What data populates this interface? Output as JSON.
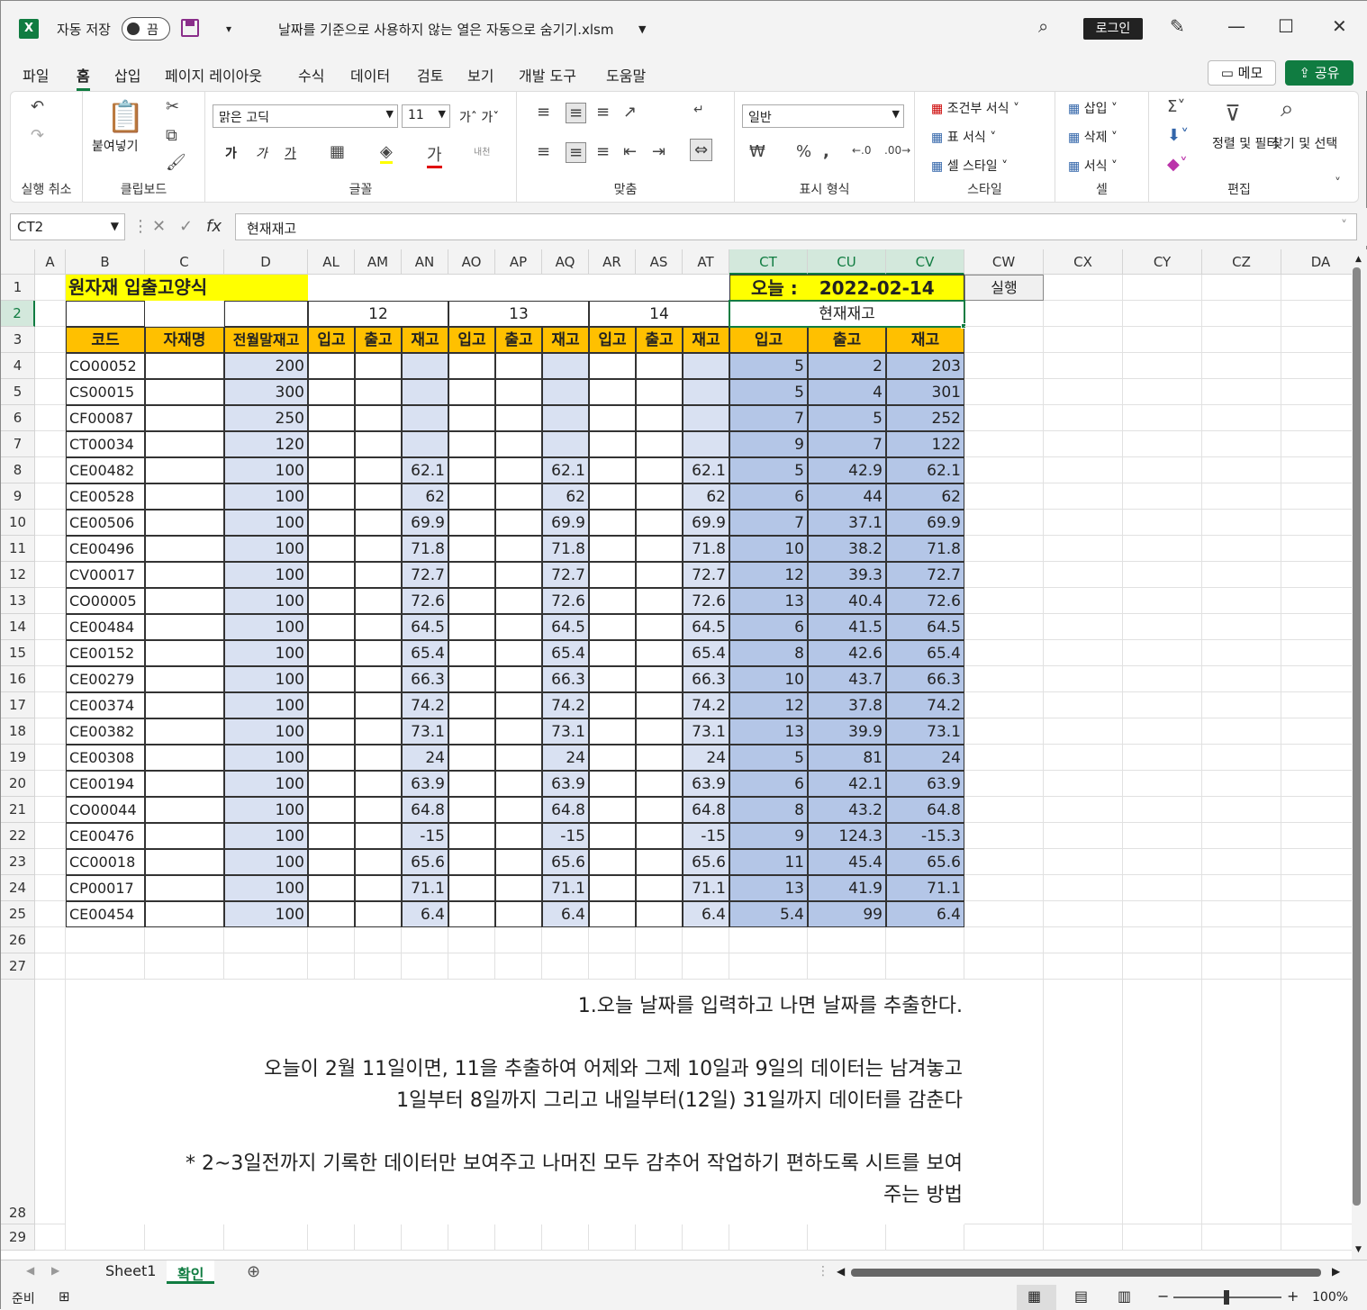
{
  "app": {
    "logo": "X",
    "autosave_label": "자동 저장",
    "autosave_state": "끔",
    "filename": "날짜를 기준으로 사용하지 않는 열은 자동으로 숨기기.xlsm",
    "login": "로그인"
  },
  "menu": [
    "파일",
    "홈",
    "삽입",
    "페이지 레이아웃",
    "수식",
    "데이터",
    "검토",
    "보기",
    "개발 도구",
    "도움말"
  ],
  "menu_active": "홈",
  "memo_label": "메모",
  "share_label": "공유",
  "ribbon": {
    "undo_label": "실행 취소",
    "clipboard": {
      "paste": "붙여넣기",
      "label": "클립보드"
    },
    "font": {
      "name": "맑은 고딕",
      "size": "11",
      "label": "글꼴",
      "bold": "가",
      "italic": "가",
      "underline": "가"
    },
    "align": {
      "label": "맞춤"
    },
    "number": {
      "format": "일반",
      "label": "표시 형식"
    },
    "styles": {
      "items": [
        "조건부 서식",
        "표 서식",
        "셀 스타일"
      ],
      "label": "스타일"
    },
    "cells": {
      "items": [
        "삽입",
        "삭제",
        "서식"
      ],
      "label": "셀"
    },
    "edit": {
      "sort": "정렬 및 필터",
      "find": "찾기 및 선택",
      "label": "편집"
    }
  },
  "namebox": "CT2",
  "formula": "현재재고",
  "columns": [
    "A",
    "B",
    "C",
    "D",
    "AL",
    "AM",
    "AN",
    "AO",
    "AP",
    "AQ",
    "AR",
    "AS",
    "AT",
    "CT",
    "CU",
    "CV",
    "CW",
    "CX",
    "CY",
    "CZ",
    "DA"
  ],
  "title": "원자재 입출고양식",
  "today_label": "오늘 :",
  "today": "2022-02-14",
  "run_button": "실행",
  "days": [
    "12",
    "13",
    "14"
  ],
  "current_stock": "현재재고",
  "headers": [
    "코드",
    "자재명",
    "전월말재고",
    "입고",
    "출고",
    "재고",
    "입고",
    "출고",
    "재고",
    "입고",
    "출고",
    "재고",
    "입고",
    "출고",
    "재고"
  ],
  "rows": [
    [
      "CO00052",
      "200",
      "",
      "",
      "",
      "",
      "",
      "",
      "",
      "",
      "",
      "5",
      "2",
      "203"
    ],
    [
      "CS00015",
      "300",
      "",
      "",
      "",
      "",
      "",
      "",
      "",
      "",
      "",
      "5",
      "4",
      "301"
    ],
    [
      "CF00087",
      "250",
      "",
      "",
      "",
      "",
      "",
      "",
      "",
      "",
      "",
      "7",
      "5",
      "252"
    ],
    [
      "CT00034",
      "120",
      "",
      "",
      "",
      "",
      "",
      "",
      "",
      "",
      "",
      "9",
      "7",
      "122"
    ],
    [
      "CE00482",
      "100",
      "",
      "",
      "62.1",
      "",
      "",
      "62.1",
      "",
      "",
      "62.1",
      "5",
      "42.9",
      "62.1"
    ],
    [
      "CE00528",
      "100",
      "",
      "",
      "62",
      "",
      "",
      "62",
      "",
      "",
      "62",
      "6",
      "44",
      "62"
    ],
    [
      "CE00506",
      "100",
      "",
      "",
      "69.9",
      "",
      "",
      "69.9",
      "",
      "",
      "69.9",
      "7",
      "37.1",
      "69.9"
    ],
    [
      "CE00496",
      "100",
      "",
      "",
      "71.8",
      "",
      "",
      "71.8",
      "",
      "",
      "71.8",
      "10",
      "38.2",
      "71.8"
    ],
    [
      "CV00017",
      "100",
      "",
      "",
      "72.7",
      "",
      "",
      "72.7",
      "",
      "",
      "72.7",
      "12",
      "39.3",
      "72.7"
    ],
    [
      "CO00005",
      "100",
      "",
      "",
      "72.6",
      "",
      "",
      "72.6",
      "",
      "",
      "72.6",
      "13",
      "40.4",
      "72.6"
    ],
    [
      "CE00484",
      "100",
      "",
      "",
      "64.5",
      "",
      "",
      "64.5",
      "",
      "",
      "64.5",
      "6",
      "41.5",
      "64.5"
    ],
    [
      "CE00152",
      "100",
      "",
      "",
      "65.4",
      "",
      "",
      "65.4",
      "",
      "",
      "65.4",
      "8",
      "42.6",
      "65.4"
    ],
    [
      "CE00279",
      "100",
      "",
      "",
      "66.3",
      "",
      "",
      "66.3",
      "",
      "",
      "66.3",
      "10",
      "43.7",
      "66.3"
    ],
    [
      "CE00374",
      "100",
      "",
      "",
      "74.2",
      "",
      "",
      "74.2",
      "",
      "",
      "74.2",
      "12",
      "37.8",
      "74.2"
    ],
    [
      "CE00382",
      "100",
      "",
      "",
      "73.1",
      "",
      "",
      "73.1",
      "",
      "",
      "73.1",
      "13",
      "39.9",
      "73.1"
    ],
    [
      "CE00308",
      "100",
      "",
      "",
      "24",
      "",
      "",
      "24",
      "",
      "",
      "24",
      "5",
      "81",
      "24"
    ],
    [
      "CE00194",
      "100",
      "",
      "",
      "63.9",
      "",
      "",
      "63.9",
      "",
      "",
      "63.9",
      "6",
      "42.1",
      "63.9"
    ],
    [
      "CO00044",
      "100",
      "",
      "",
      "64.8",
      "",
      "",
      "64.8",
      "",
      "",
      "64.8",
      "8",
      "43.2",
      "64.8"
    ],
    [
      "CE00476",
      "100",
      "",
      "",
      "-15",
      "",
      "",
      "-15",
      "",
      "",
      "-15",
      "9",
      "124.3",
      "-15.3"
    ],
    [
      "CC00018",
      "100",
      "",
      "",
      "65.6",
      "",
      "",
      "65.6",
      "",
      "",
      "65.6",
      "11",
      "45.4",
      "65.6"
    ],
    [
      "CP00017",
      "100",
      "",
      "",
      "71.1",
      "",
      "",
      "71.1",
      "",
      "",
      "71.1",
      "13",
      "41.9",
      "71.1"
    ],
    [
      "CE00454",
      "100",
      "",
      "",
      "6.4",
      "",
      "",
      "6.4",
      "",
      "",
      "6.4",
      "5.4",
      "99",
      "6.4"
    ]
  ],
  "notes": [
    "1.오늘 날짜를 입력하고 나면 날짜를 추출한다.",
    "",
    "오늘이 2월 11일이면,  11을 추출하여 어제와 그제 10일과 9일의 데이터는 남겨놓고",
    "1일부터 8일까지 그리고 내일부터(12일) 31일까지 데이터를 감춘다",
    "",
    "* 2~3일전까지 기록한 데이터만 보여주고 나머진 모두 감추어 작업하기 편하도록 시트를 보여",
    "주는 방법"
  ],
  "sheets": [
    "Sheet1",
    "확인"
  ],
  "status": {
    "ready": "준비",
    "zoom": "100%"
  }
}
